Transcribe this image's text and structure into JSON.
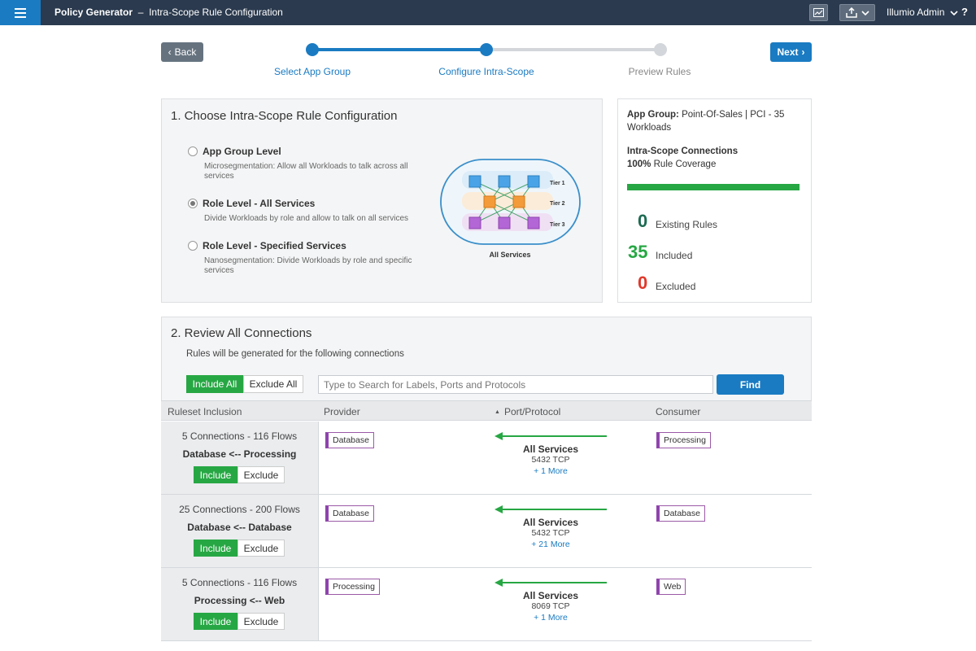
{
  "topbar": {
    "app_name": "Policy Generator",
    "separator": "–",
    "page_name": "Intra-Scope Rule Configuration",
    "user": "Illumio Admin",
    "help": "?"
  },
  "wizard": {
    "back_label": "Back",
    "next_label": "Next",
    "steps": [
      {
        "label": "Select App Group",
        "state": "done"
      },
      {
        "label": "Configure Intra-Scope",
        "state": "current"
      },
      {
        "label": "Preview Rules",
        "state": "pending"
      }
    ]
  },
  "config": {
    "heading": "1. Choose Intra-Scope Rule Configuration",
    "options": [
      {
        "title": "App Group Level",
        "desc": "Microsegmentation: Allow all Workloads to talk across all services",
        "selected": false
      },
      {
        "title": "Role Level - All Services",
        "desc": "Divide Workloads by role and allow to talk on all services",
        "selected": true
      },
      {
        "title": "Role Level - Specified Services",
        "desc": "Nanosegmentation: Divide Workloads by role and specific services",
        "selected": false
      }
    ],
    "diagram": {
      "tiers": [
        "Tier 1",
        "Tier 2",
        "Tier 3"
      ],
      "caption": "All Services"
    }
  },
  "summary": {
    "app_group_label": "App Group:",
    "app_group_value": "Point-Of-Sales | PCI - 35 Workloads",
    "connections_title": "Intra-Scope Connections",
    "coverage_value": "100%",
    "coverage_label": "Rule Coverage",
    "coverage_fraction": 1.0,
    "stats": [
      {
        "value": "0",
        "label": "Existing Rules",
        "color": "#1d6b52"
      },
      {
        "value": "35",
        "label": "Included",
        "color": "#27a744"
      },
      {
        "value": "0",
        "label": "Excluded",
        "color": "#e0392b"
      }
    ]
  },
  "connections": {
    "heading": "2. Review All Connections",
    "subtitle": "Rules will be generated for the following connections",
    "include_all": "Include All",
    "exclude_all": "Exclude All",
    "search_placeholder": "Type to Search for Labels, Ports and Protocols",
    "find_label": "Find",
    "columns": [
      "Ruleset Inclusion",
      "Provider",
      "Port/Protocol",
      "Consumer"
    ],
    "include_label": "Include",
    "exclude_label": "Exclude",
    "rows": [
      {
        "count": "5 Connections - 116 Flows",
        "pair": "Database <-- Processing",
        "provider": "Database",
        "consumer": "Processing",
        "service": "All Services",
        "port": "5432 TCP",
        "more": "+ 1 More"
      },
      {
        "count": "25 Connections - 200 Flows",
        "pair": "Database <-- Database",
        "provider": "Database",
        "consumer": "Database",
        "service": "All Services",
        "port": "5432 TCP",
        "more": "+ 21 More"
      },
      {
        "count": "5 Connections - 116 Flows",
        "pair": "Processing <-- Web",
        "provider": "Processing",
        "consumer": "Web",
        "service": "All Services",
        "port": "8069 TCP",
        "more": "+ 1 More"
      }
    ]
  },
  "colors": {
    "topbar": "#2b3a4e",
    "accent_blue": "#1a7bc2",
    "include_green": "#27a744",
    "label_purple": "#8e44ad"
  }
}
